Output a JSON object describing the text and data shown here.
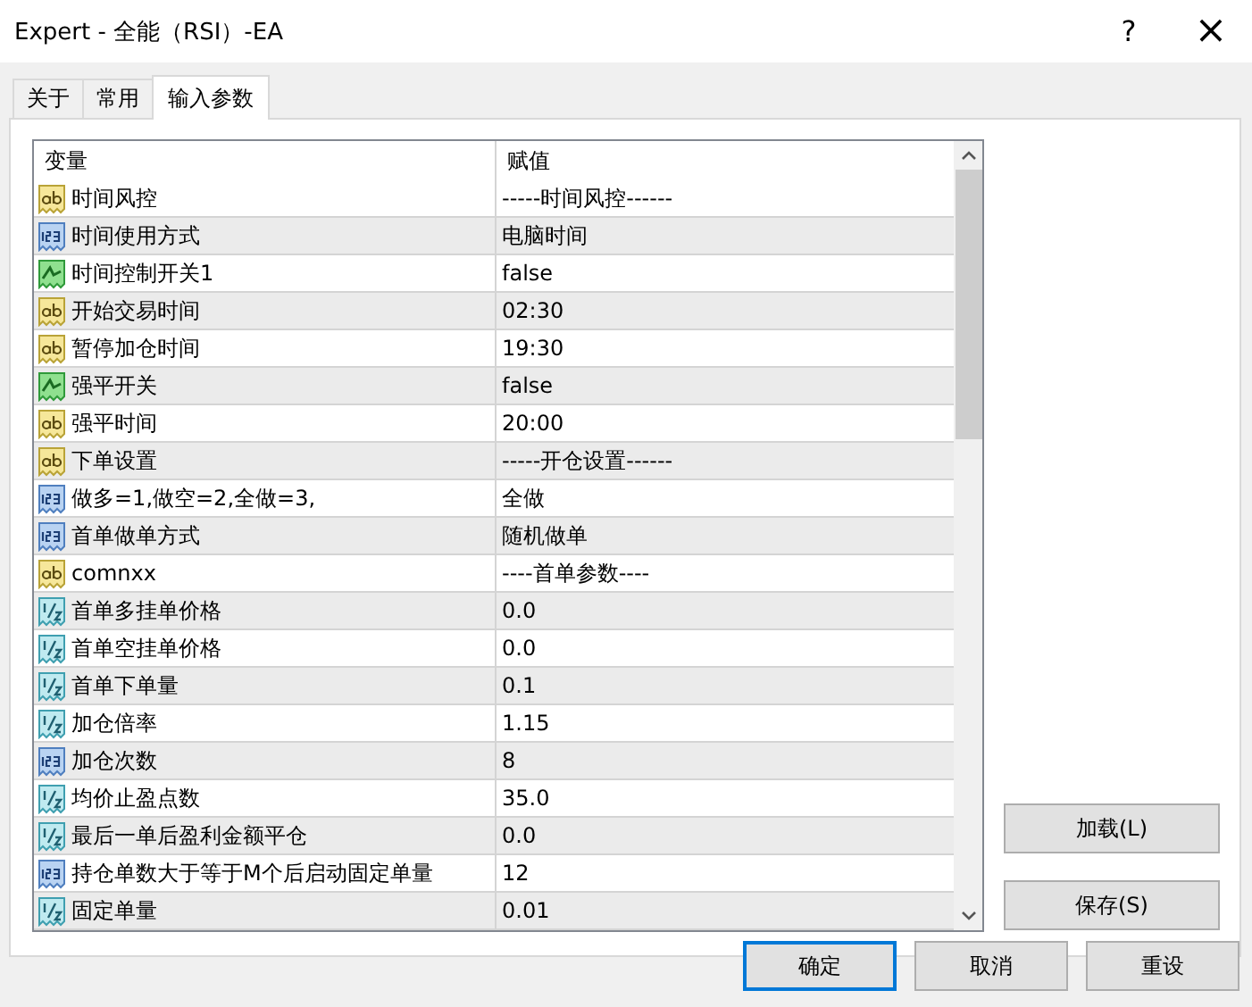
{
  "window": {
    "title": "Expert - 全能（RSI）-EA",
    "help": "?",
    "close": "×"
  },
  "tabs": [
    {
      "label": "关于",
      "selected": false
    },
    {
      "label": "常用",
      "selected": false
    },
    {
      "label": "输入参数",
      "selected": true
    }
  ],
  "table": {
    "columns": [
      "变量",
      "赋值"
    ],
    "rows": [
      {
        "kind": "text",
        "name": "时间风控",
        "value": "-----时间风控------"
      },
      {
        "kind": "integer",
        "name": "时间使用方式",
        "value": "电脑时间"
      },
      {
        "kind": "boolean",
        "name": "时间控制开关1",
        "value": "false"
      },
      {
        "kind": "text",
        "name": "开始交易时间",
        "value": "02:30"
      },
      {
        "kind": "text",
        "name": "暂停加仓时间",
        "value": "19:30"
      },
      {
        "kind": "boolean",
        "name": "强平开关",
        "value": "false"
      },
      {
        "kind": "text",
        "name": "强平时间",
        "value": "20:00"
      },
      {
        "kind": "text",
        "name": "下单设置",
        "value": "-----开仓设置------"
      },
      {
        "kind": "integer",
        "name": "做多=1,做空=2,全做=3,",
        "value": "全做"
      },
      {
        "kind": "integer",
        "name": "首单做单方式",
        "value": "随机做单"
      },
      {
        "kind": "text",
        "name": "comnxx",
        "value": "----首单参数----"
      },
      {
        "kind": "decimal",
        "name": "首单多挂单价格",
        "value": "0.0"
      },
      {
        "kind": "decimal",
        "name": "首单空挂单价格",
        "value": "0.0"
      },
      {
        "kind": "decimal",
        "name": "首单下单量",
        "value": "0.1"
      },
      {
        "kind": "decimal",
        "name": "加仓倍率",
        "value": "1.15"
      },
      {
        "kind": "integer",
        "name": "加仓次数",
        "value": "8"
      },
      {
        "kind": "decimal",
        "name": "均价止盈点数",
        "value": "35.0"
      },
      {
        "kind": "decimal",
        "name": "最后一单后盈利金额平仓",
        "value": "0.0"
      },
      {
        "kind": "integer",
        "name": "持仓单数大于等于M个后启动固定单量",
        "value": "12"
      },
      {
        "kind": "decimal",
        "name": "固定单量",
        "value": "0.01"
      }
    ]
  },
  "side_buttons": [
    "加载(L)",
    "保存(S)"
  ],
  "buttons": [
    {
      "label": "确定",
      "selected": true
    },
    {
      "label": "取消",
      "selected": false
    },
    {
      "label": "重设",
      "selected": false
    }
  ]
}
